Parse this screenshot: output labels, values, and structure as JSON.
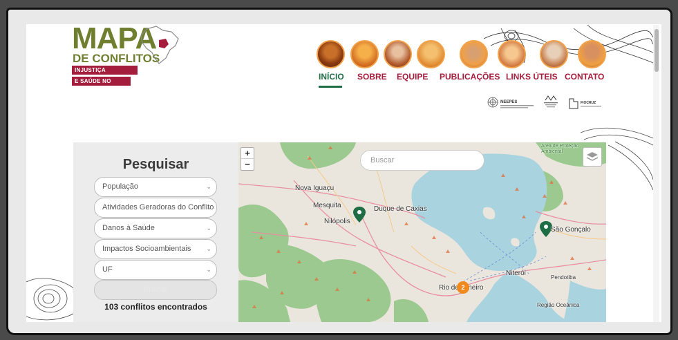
{
  "logo": {
    "title": "MAPA",
    "subtitle": "DE CONFLITOS",
    "tag1": "INJUSTIÇA AMBIENTAL",
    "tag2": "E SAÚDE NO BRASIL"
  },
  "nav": {
    "items": [
      {
        "label": "INÍCIO",
        "active": true
      },
      {
        "label": "SOBRE"
      },
      {
        "label": "EQUIPE"
      },
      {
        "label": "PUBLICAÇÕES"
      },
      {
        "label": "LINKS ÚTEIS"
      },
      {
        "label": "CONTATO"
      }
    ]
  },
  "partners": {
    "neepes": "NEEPES",
    "fiocruz": "FIOCRUZ"
  },
  "search": {
    "title": "Pesquisar",
    "filters": [
      "População",
      "Atividades Geradoras do Conflito",
      "Danos à Saúde",
      "Impactos Socioambientais",
      "UF"
    ],
    "button_label": "Buscar",
    "results": "103 conflitos encontrados"
  },
  "map": {
    "search_placeholder": "Buscar",
    "zoom_in": "+",
    "zoom_out": "−",
    "cluster_count": "2",
    "labels": [
      "Nova Iguaçu",
      "Mesquita",
      "Duque de Caxias",
      "Nilópolis",
      "São Gonçalo",
      "Niterói",
      "Rio de Janeiro",
      "Região Oceânica",
      "Pendotiba",
      "Área de Proteção Ambiental"
    ]
  },
  "colors": {
    "brand_olive": "#6f7f2f",
    "brand_red": "#a51d3c",
    "active_green": "#1f6d45",
    "marker_green": "#1f6d45",
    "cluster_orange": "#f08a1c"
  }
}
